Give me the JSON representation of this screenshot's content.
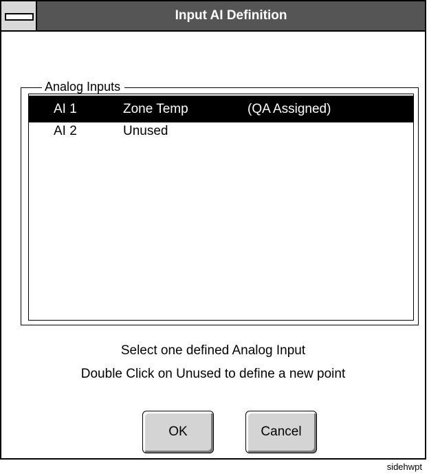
{
  "window": {
    "title": "Input AI Definition",
    "system_menu_icon": "system-menu-icon"
  },
  "group": {
    "label": "Analog Inputs"
  },
  "list": {
    "items": [
      {
        "id": "AI 1",
        "name": "Zone Temp",
        "status": "(QA Assigned)",
        "selected": true
      },
      {
        "id": "AI 2",
        "name": "Unused",
        "status": "",
        "selected": false
      }
    ]
  },
  "instructions": {
    "line1": "Select one defined Analog Input",
    "line2": "Double Click on Unused to define a new point"
  },
  "buttons": {
    "ok": "OK",
    "cancel": "Cancel"
  },
  "footnote": "sidehwpt",
  "colors": {
    "titlebar": "#555555",
    "selection": "#000000",
    "button_face": "#d4d4d4"
  }
}
